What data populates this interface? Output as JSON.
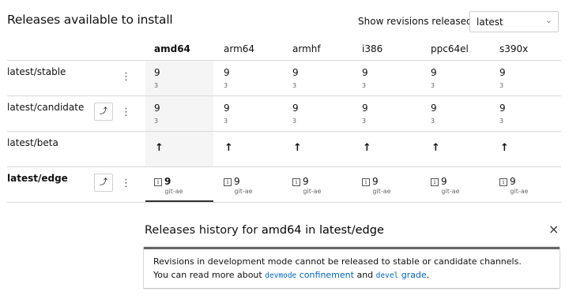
{
  "header": {
    "title": "Releases available to install",
    "revisions_label": "Show revisions released in",
    "revisions_select": "latest",
    "chevron_icon": "chevron-down-icon"
  },
  "columns": [
    "amd64",
    "arm64",
    "armhf",
    "i386",
    "ppc64el",
    "s390x"
  ],
  "selected_column": "amd64",
  "rows": [
    {
      "channel": "latest/stable",
      "has_promote": false,
      "values": [
        "9",
        "9",
        "9",
        "9",
        "9",
        "9"
      ],
      "subs": [
        "3",
        "3",
        "3",
        "3",
        "3",
        "3"
      ]
    },
    {
      "channel": "latest/candidate",
      "has_promote": true,
      "values": [
        "9",
        "9",
        "9",
        "9",
        "9",
        "9"
      ],
      "subs": [
        "3",
        "3",
        "3",
        "3",
        "3",
        "3"
      ]
    },
    {
      "channel": "latest/beta",
      "has_promote": false,
      "arrow": "↑"
    },
    {
      "channel": "latest/edge",
      "has_promote": true,
      "values": [
        "9",
        "9",
        "9",
        "9",
        "9",
        "9"
      ],
      "subs": [
        "git-ae",
        "git-ae",
        "git-ae",
        "git-ae",
        "git-ae",
        "git-ae"
      ],
      "info_icon": "i"
    }
  ],
  "icons": {
    "promote": "⤴",
    "menu": "⋮",
    "close": "×"
  },
  "history": {
    "prefix": "Releases history for ",
    "arch": "amd64",
    "middle": " in ",
    "channel": "latest/edge"
  },
  "notice": {
    "line1": "Revisions in development mode cannot be released to stable or candidate channels.",
    "line2_pre": "You can read more about ",
    "code1": "devmode",
    "link1": "confinement",
    "and": " and ",
    "code2": "devel",
    "link2": "grade",
    "end": "."
  }
}
